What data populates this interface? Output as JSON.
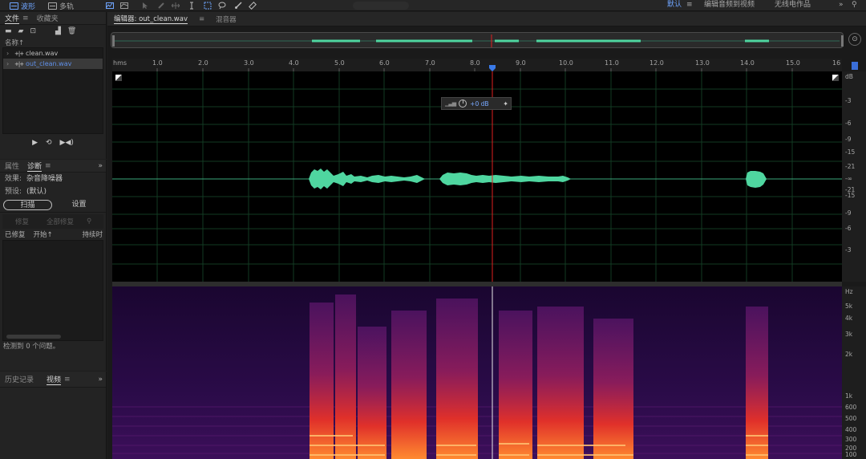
{
  "toolbar": {
    "waveform_label": "波形",
    "multitrack_label": "多轨",
    "workspace_default": "默认",
    "workspace_edit_audio_to_video": "编辑音频到视频",
    "workspace_radio": "无线电作品"
  },
  "files_panel": {
    "tab_files": "文件",
    "tab_favorites": "收藏夹",
    "name_header": "名称↑",
    "files": [
      {
        "name": "clean.wav",
        "selected": false
      },
      {
        "name": "out_clean.wav",
        "selected": true
      }
    ]
  },
  "diagnostics_panel": {
    "tab_properties": "属性",
    "tab_diagnostics": "诊断",
    "effect_label": "效果:",
    "effect_value": "杂音降噪器",
    "preset_label": "预设:",
    "preset_value": "(默认)",
    "scan_label": "扫描",
    "settings_label": "设置",
    "repair_label": "修复",
    "repair_all_label": "全部修复",
    "col_repaired": "已修复",
    "col_start": "开始↑",
    "col_duration": "持续时",
    "status": "检测到 0 个问题。"
  },
  "history_panel": {
    "tab_history": "历史记录",
    "tab_video": "视频"
  },
  "editor": {
    "tab_editor": "编辑器: out_clean.wav",
    "tab_mixer": "混音器",
    "hud_gain": "+0 dB",
    "ruler_unit": "hms",
    "ruler_labels": [
      "1.0",
      "2.0",
      "3.0",
      "4.0",
      "5.0",
      "6.0",
      "7.0",
      "8.0",
      "9.0",
      "10.0",
      "11.0",
      "12.0",
      "13.0",
      "14.0",
      "15.0",
      "16"
    ],
    "db_unit": "dB",
    "db_labels": [
      "-3",
      "-6",
      "-9",
      "-15",
      "-21",
      "-∞",
      "-21",
      "-15",
      "-9",
      "-6",
      "-3"
    ],
    "hz_unit": "Hz",
    "hz_labels": [
      "5k",
      "4k",
      "3k",
      "2k",
      "1k",
      "600",
      "500",
      "400",
      "300",
      "200",
      "100"
    ]
  },
  "colors": {
    "accent": "#5f8fe8",
    "waveform": "#4fd6a0",
    "playhead": "#e02020",
    "spectral_bg": "#20083a"
  }
}
